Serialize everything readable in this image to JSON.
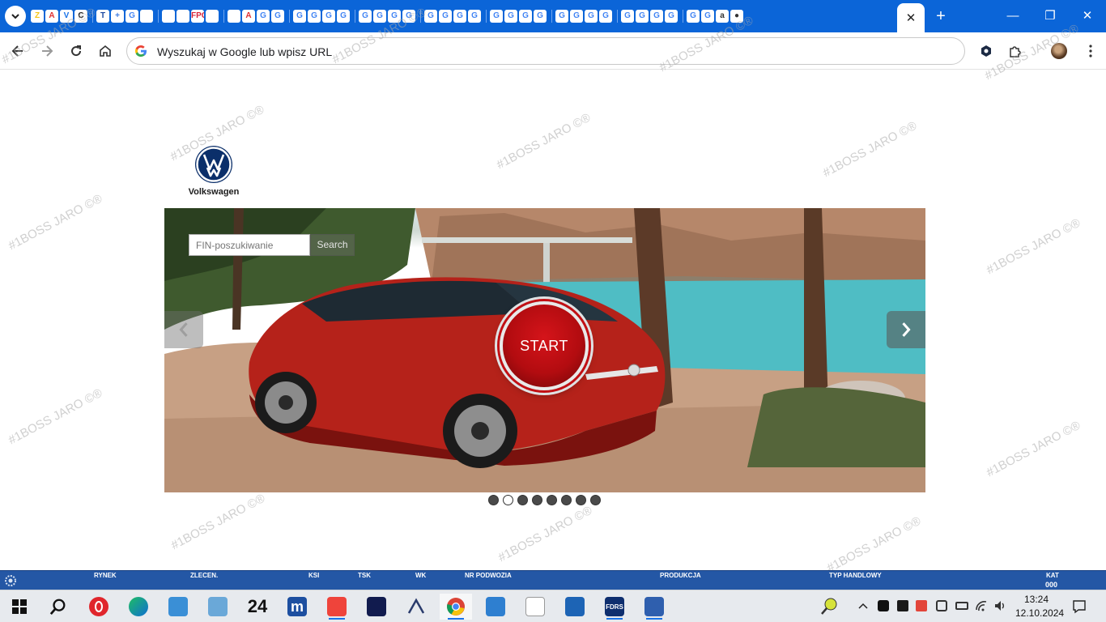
{
  "browser": {
    "active_tab_close": "✕",
    "new_tab": "+",
    "window_controls": {
      "minimize": "—",
      "maximize": "❐",
      "close": "✕"
    },
    "favicons": [
      "Z",
      "A",
      "V",
      "C",
      "T",
      "+",
      "G",
      "",
      "",
      "",
      "FPG",
      "",
      "",
      "A",
      "G",
      "G",
      "G",
      "G",
      "G",
      "G",
      "G",
      "G",
      "G",
      "G",
      "G",
      "G",
      "G",
      "G",
      "G",
      "G",
      "G",
      "G",
      "G",
      "G",
      "G",
      "G",
      "G",
      "G",
      "G",
      "G",
      "G",
      "G",
      "a",
      "●"
    ],
    "omnibox_placeholder": "Wyszukaj w Google lub wpisz URL"
  },
  "page": {
    "brand_name": "Volkswagen",
    "watermark_text": "#1BOSS JARO ©®",
    "search": {
      "placeholder": "FIN-poszukiwanie",
      "button_label": "Search"
    },
    "start_label": "START",
    "carousel_dots": 8,
    "carousel_active_dot": 1
  },
  "statusbar": {
    "labels": [
      "RYNEK",
      "ZLECEN.",
      "KSI",
      "TSK",
      "WK",
      "NR PODWOZIA",
      "PRODUKCJA",
      "TYP HANDLOWY",
      "KAT"
    ],
    "kat_value": "000"
  },
  "taskbar": {
    "apps": [
      "start-icon",
      "search-icon",
      "opera-icon",
      "edge-icon",
      "control-panel-icon",
      "laptop-icon",
      "24-icon",
      "m-icon",
      "anydesk-icon",
      "ford-icon",
      "arrow-icon",
      "chrome-icon",
      "remote-icon",
      "connector-icon",
      "a-icon",
      "fdrs-icon",
      "ford-icon-2"
    ],
    "app_24_label": "24",
    "app_m_label": "m",
    "app_fdrs_label": "FDRS",
    "clock": {
      "time": "13:24",
      "date": "12.10.2024"
    }
  },
  "colors": {
    "tabstrip": "#0b65d8",
    "statusbar": "#2457a5",
    "start_red": "#c20f14"
  }
}
